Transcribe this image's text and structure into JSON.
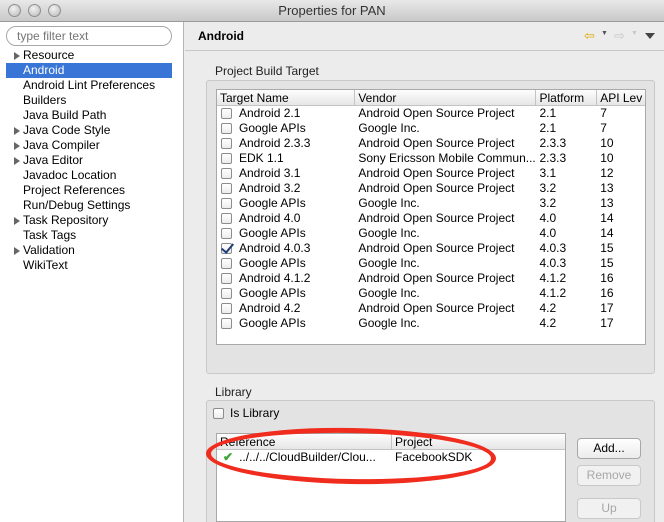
{
  "window": {
    "title": "Properties for PAN"
  },
  "sidebar": {
    "filter_placeholder": "type filter text",
    "items": [
      {
        "label": "Resource",
        "expandable": true
      },
      {
        "label": "Android",
        "selected": true
      },
      {
        "label": "Android Lint Preferences"
      },
      {
        "label": "Builders"
      },
      {
        "label": "Java Build Path"
      },
      {
        "label": "Java Code Style",
        "expandable": true
      },
      {
        "label": "Java Compiler",
        "expandable": true
      },
      {
        "label": "Java Editor",
        "expandable": true
      },
      {
        "label": "Javadoc Location"
      },
      {
        "label": "Project References"
      },
      {
        "label": "Run/Debug Settings"
      },
      {
        "label": "Task Repository",
        "expandable": true
      },
      {
        "label": "Task Tags"
      },
      {
        "label": "Validation",
        "expandable": true
      },
      {
        "label": "WikiText"
      }
    ]
  },
  "header": {
    "title": "Android",
    "back_icon": "back-arrow-icon",
    "forward_icon": "forward-arrow-icon",
    "menu_icon": "view-menu-icon"
  },
  "build_target": {
    "group_label": "Project Build Target",
    "columns": [
      "Target Name",
      "Vendor",
      "Platform",
      "API Lev"
    ],
    "rows": [
      {
        "name": "Android 2.1",
        "vendor": "Android Open Source Project",
        "platform": "2.1",
        "api": "7",
        "checked": false
      },
      {
        "name": "Google APIs",
        "vendor": "Google Inc.",
        "platform": "2.1",
        "api": "7",
        "checked": false
      },
      {
        "name": "Android 2.3.3",
        "vendor": "Android Open Source Project",
        "platform": "2.3.3",
        "api": "10",
        "checked": false
      },
      {
        "name": "EDK 1.1",
        "vendor": "Sony Ericsson Mobile Commun...",
        "platform": "2.3.3",
        "api": "10",
        "checked": false
      },
      {
        "name": "Android 3.1",
        "vendor": "Android Open Source Project",
        "platform": "3.1",
        "api": "12",
        "checked": false
      },
      {
        "name": "Android 3.2",
        "vendor": "Android Open Source Project",
        "platform": "3.2",
        "api": "13",
        "checked": false
      },
      {
        "name": "Google APIs",
        "vendor": "Google Inc.",
        "platform": "3.2",
        "api": "13",
        "checked": false
      },
      {
        "name": "Android 4.0",
        "vendor": "Android Open Source Project",
        "platform": "4.0",
        "api": "14",
        "checked": false
      },
      {
        "name": "Google APIs",
        "vendor": "Google Inc.",
        "platform": "4.0",
        "api": "14",
        "checked": false
      },
      {
        "name": "Android 4.0.3",
        "vendor": "Android Open Source Project",
        "platform": "4.0.3",
        "api": "15",
        "checked": true
      },
      {
        "name": "Google APIs",
        "vendor": "Google Inc.",
        "platform": "4.0.3",
        "api": "15",
        "checked": false
      },
      {
        "name": "Android 4.1.2",
        "vendor": "Android Open Source Project",
        "platform": "4.1.2",
        "api": "16",
        "checked": false
      },
      {
        "name": "Google APIs",
        "vendor": "Google Inc.",
        "platform": "4.1.2",
        "api": "16",
        "checked": false
      },
      {
        "name": "Android 4.2",
        "vendor": "Android Open Source Project",
        "platform": "4.2",
        "api": "17",
        "checked": false
      },
      {
        "name": "Google APIs",
        "vendor": "Google Inc.",
        "platform": "4.2",
        "api": "17",
        "checked": false
      }
    ]
  },
  "library": {
    "group_label": "Library",
    "is_library_label": "Is Library",
    "is_library_checked": false,
    "columns": [
      "Reference",
      "Project"
    ],
    "rows": [
      {
        "reference": "../../../CloudBuilder/Clou...",
        "project": "FacebookSDK",
        "status_icon": "green-check-icon"
      }
    ],
    "buttons": {
      "add": "Add...",
      "remove": "Remove",
      "up": "Up"
    },
    "annotation_color": "#ef2c1d"
  }
}
